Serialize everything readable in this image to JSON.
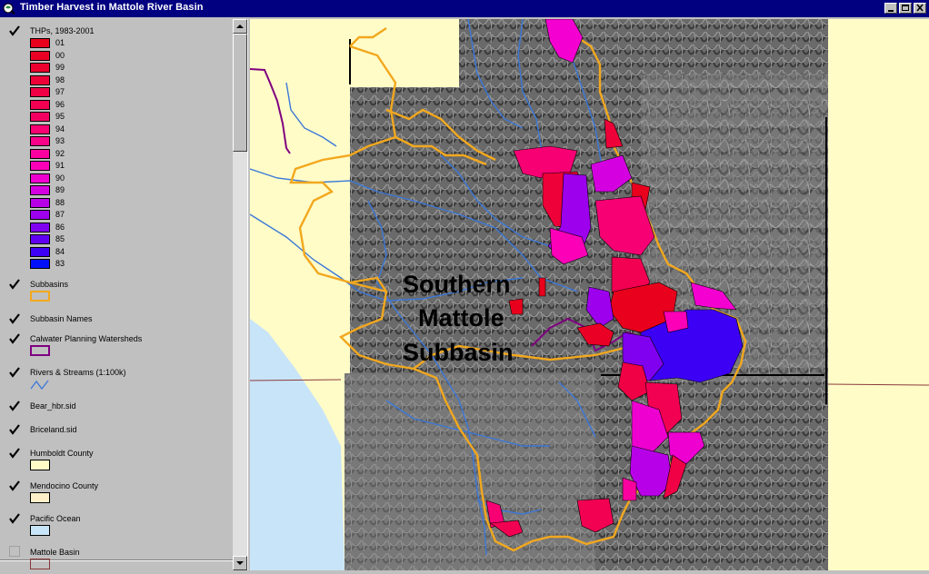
{
  "window": {
    "title": "Timber Harvest in Mattole River Basin"
  },
  "toc": {
    "thp_layer": {
      "label": "THPs, 1983-2001",
      "legend": [
        {
          "label": "01",
          "color": "#e8001c"
        },
        {
          "label": "00",
          "color": "#ea0024"
        },
        {
          "label": "99",
          "color": "#ec002e"
        },
        {
          "label": "98",
          "color": "#ee0038"
        },
        {
          "label": "97",
          "color": "#f00044"
        },
        {
          "label": "96",
          "color": "#f20052"
        },
        {
          "label": "95",
          "color": "#f40062"
        },
        {
          "label": "94",
          "color": "#f60074"
        },
        {
          "label": "93",
          "color": "#f80088"
        },
        {
          "label": "92",
          "color": "#fa009e"
        },
        {
          "label": "91",
          "color": "#fc00b8"
        },
        {
          "label": "90",
          "color": "#ee00d0"
        },
        {
          "label": "89",
          "color": "#d400e0"
        },
        {
          "label": "88",
          "color": "#b800e8"
        },
        {
          "label": "87",
          "color": "#9c00ec"
        },
        {
          "label": "86",
          "color": "#8000f0"
        },
        {
          "label": "85",
          "color": "#6200f2"
        },
        {
          "label": "84",
          "color": "#3c00f4"
        },
        {
          "label": "83",
          "color": "#0010f8"
        }
      ]
    },
    "layers": [
      {
        "label": "Subbasins",
        "symbol": "outline",
        "color": "#f2a81e"
      },
      {
        "label": "Subbasin Names",
        "symbol": "none"
      },
      {
        "label": "Calwater Planning Watersheds",
        "symbol": "outline",
        "color": "#800080"
      },
      {
        "label": "Rivers & Streams (1:100k)",
        "symbol": "line",
        "color": "#3c78d8"
      },
      {
        "label": "Bear_hbr.sid",
        "symbol": "none"
      },
      {
        "label": "Briceland.sid",
        "symbol": "none"
      },
      {
        "label": "Humboldt County",
        "symbol": "fill",
        "color": "#fffcc8"
      },
      {
        "label": "Mendocino County",
        "symbol": "fill",
        "color": "#fff0c8"
      },
      {
        "label": "Pacific Ocean",
        "symbol": "fill",
        "color": "#c8e4f8"
      }
    ],
    "unchecked_layer": {
      "label": "Mattole Basin",
      "color": "#8b3a3a"
    }
  },
  "map": {
    "label_line1": "Southern",
    "label_line2": "Mattole",
    "label_line3": "Subbasin"
  }
}
